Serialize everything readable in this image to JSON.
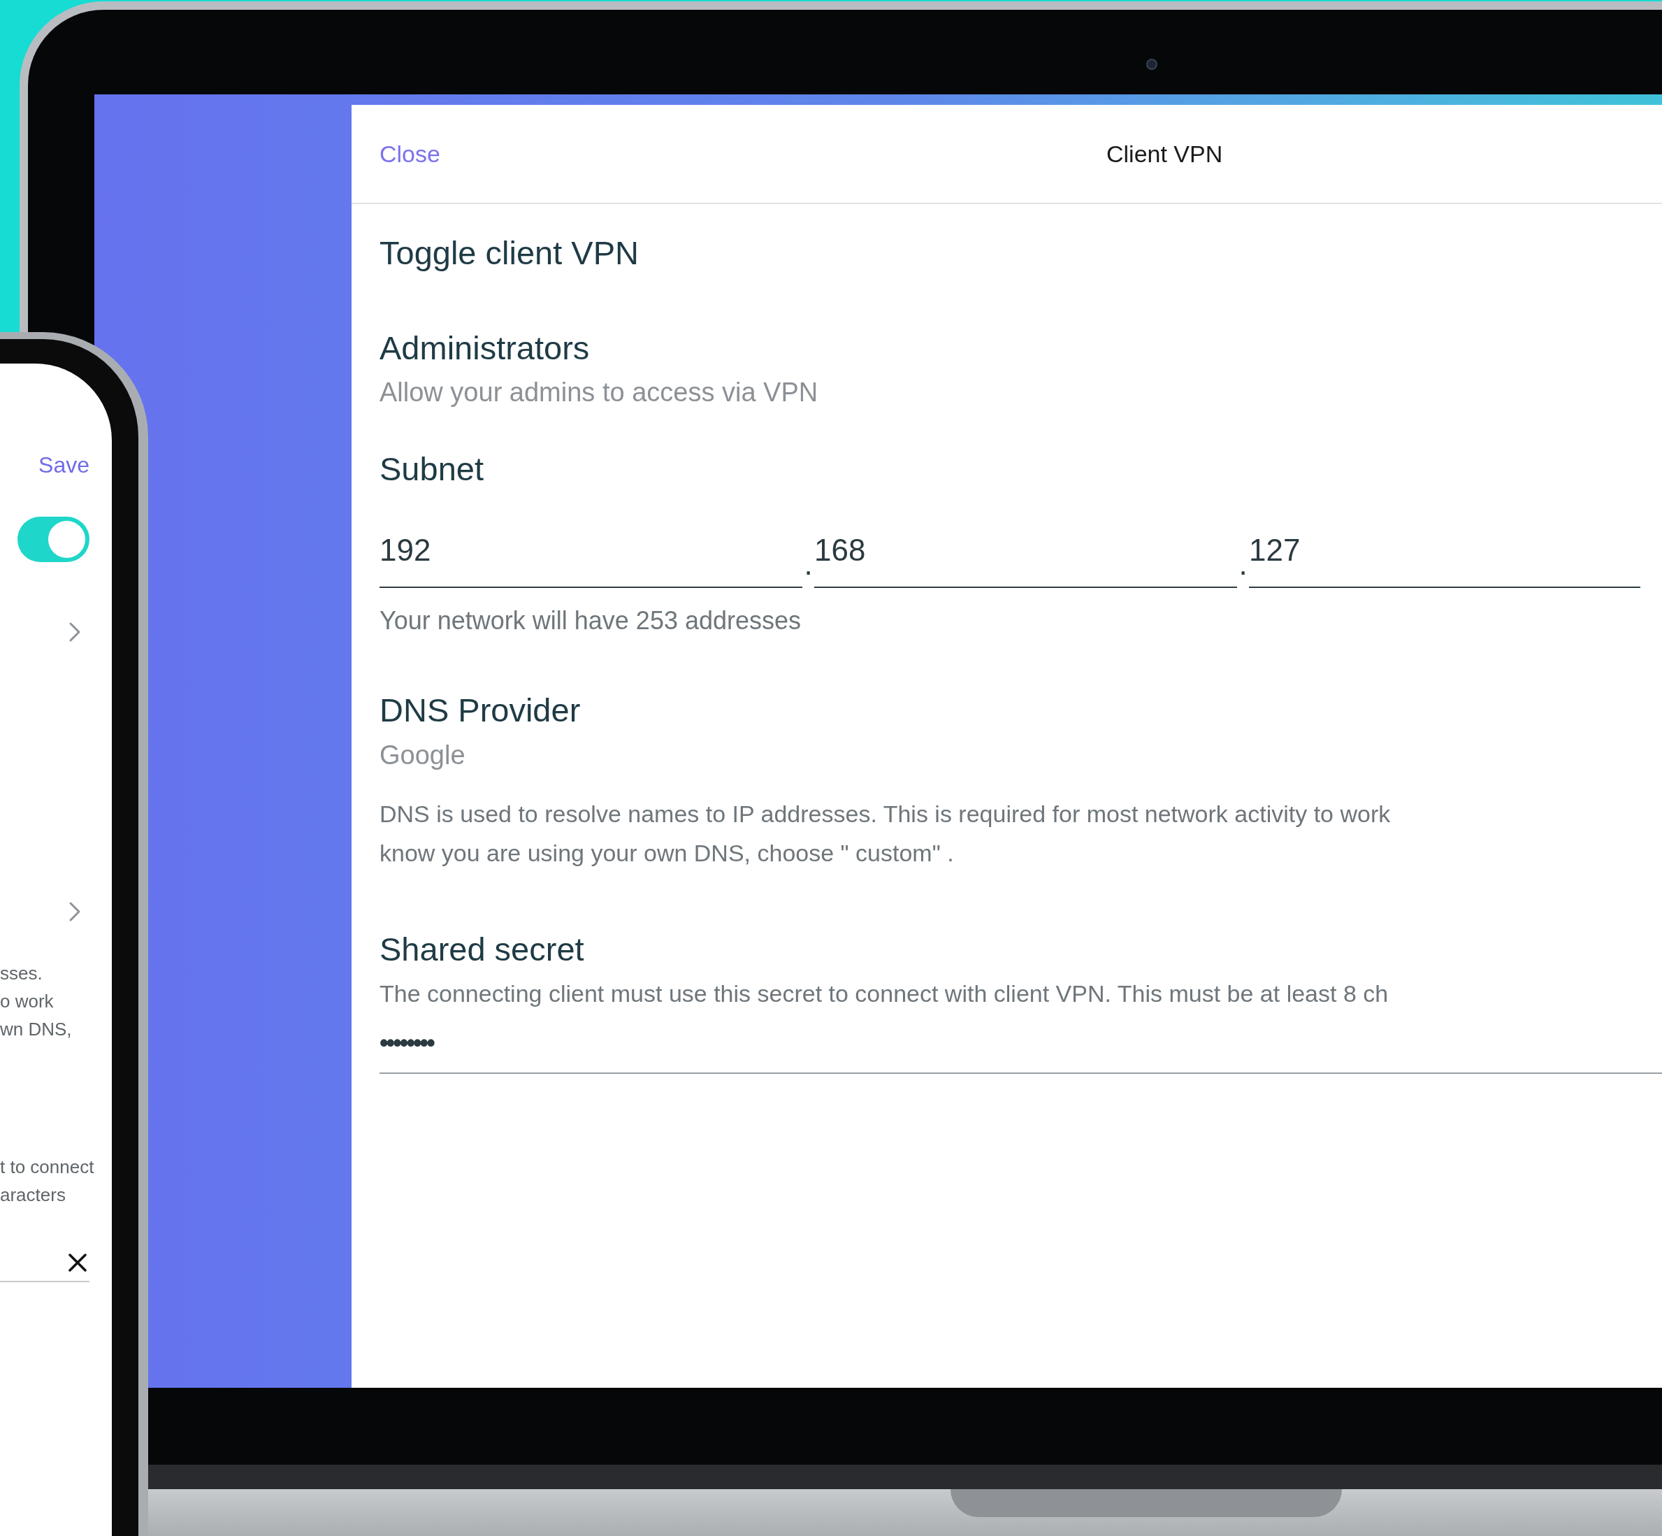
{
  "laptop_screen": {
    "header": {
      "close_link": "Close",
      "title": "Client VPN"
    },
    "toggle_client_vpn": {
      "label": "Toggle client VPN"
    },
    "administrators": {
      "label": "Administrators",
      "description": "Allow your admins to access via VPN"
    },
    "subnet": {
      "label": "Subnet",
      "octets": [
        {
          "value": "192"
        },
        {
          "separator": ".",
          "value": "168"
        },
        {
          "separator": ".",
          "value": "127"
        }
      ],
      "hint": "Your network will have 253 addresses"
    },
    "dns_provider": {
      "label": "DNS Provider",
      "value": "Google",
      "description_lines": [
        "DNS is used to resolve names to IP addresses. This is required for most network activity to work",
        "know you are using your own DNS, choose \" custom\" ."
      ]
    },
    "shared_secret": {
      "label": "Shared secret",
      "description": "The connecting client must use this secret to connect with client VPN. This must be at least 8 ch",
      "value": "••••••••"
    }
  },
  "phone_screen": {
    "save_link": "Save",
    "toggle": {
      "on": true
    },
    "text_block_1": [
      "sses.",
      "o work",
      "wn DNS,"
    ],
    "text_block_2": [
      "t to connect",
      "aracters"
    ]
  }
}
